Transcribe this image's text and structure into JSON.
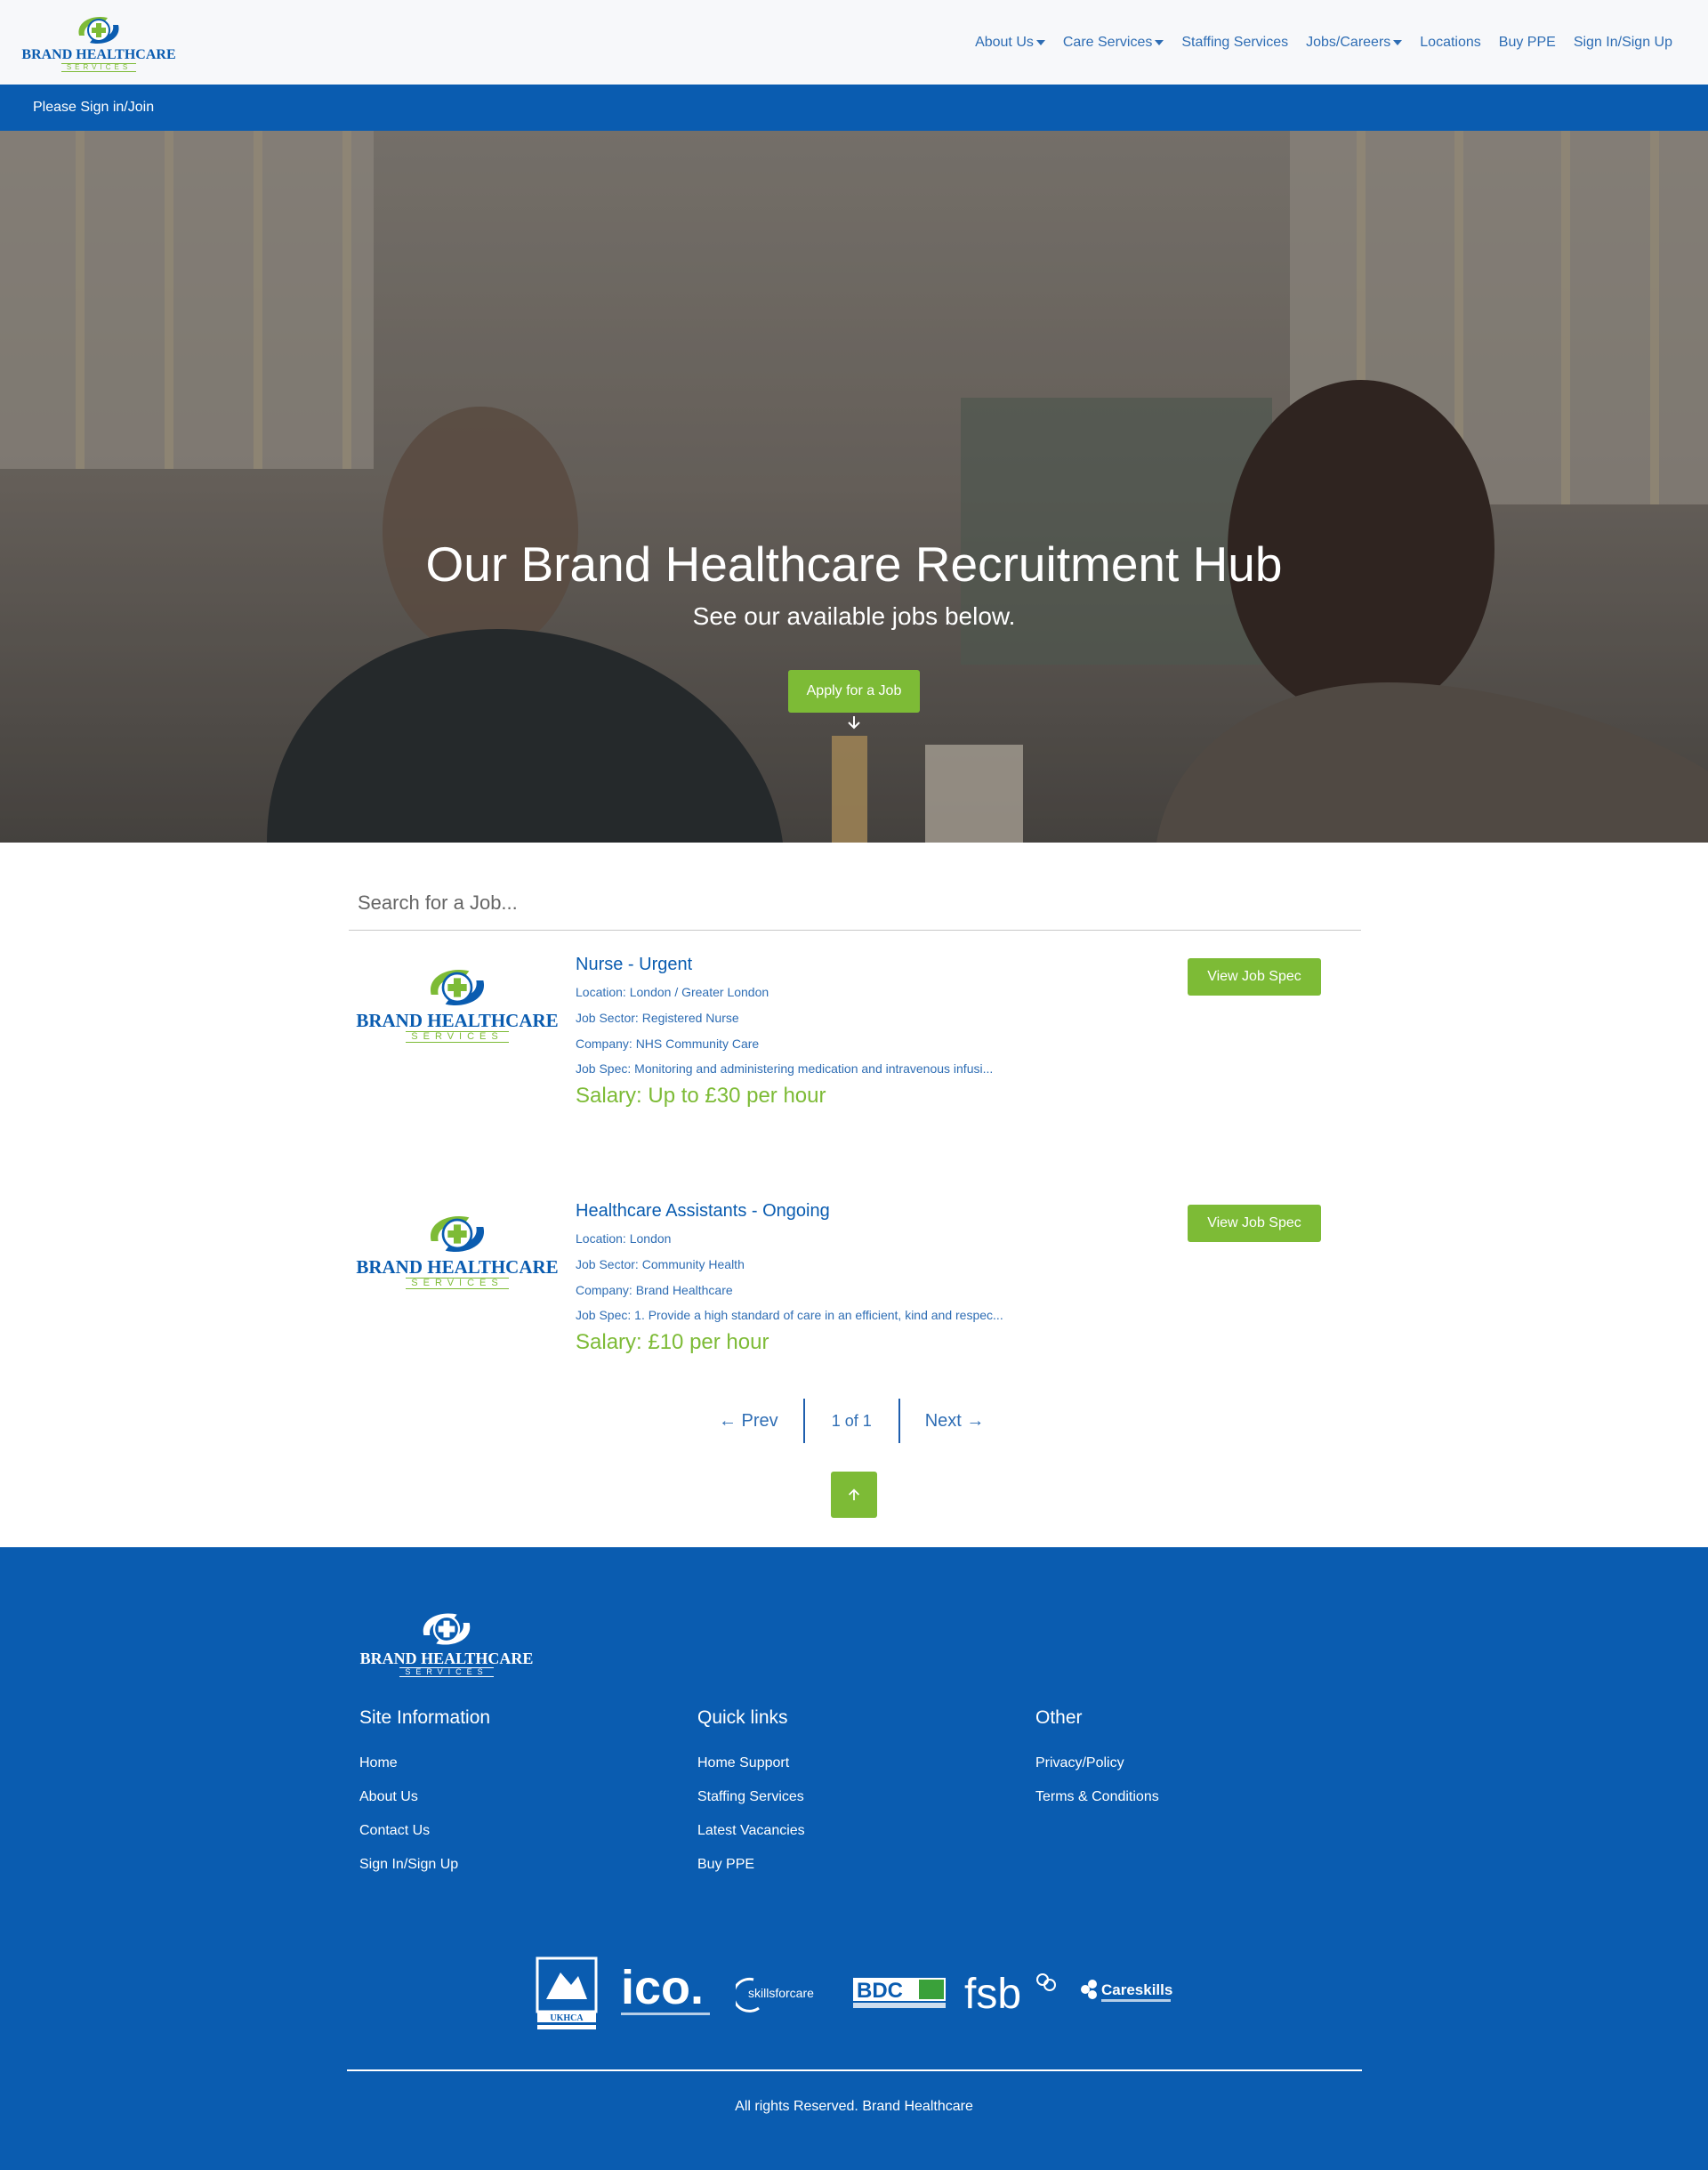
{
  "brand": {
    "name": "BRAND HEALTHCARE",
    "sub": "SERVICES",
    "primary": "#0a5cb0",
    "accent": "#7dbb36"
  },
  "nav": {
    "items": [
      {
        "label": "About Us",
        "dropdown": true
      },
      {
        "label": "Care Services",
        "dropdown": true
      },
      {
        "label": "Staffing Services",
        "dropdown": false
      },
      {
        "label": "Jobs/Careers",
        "dropdown": true
      },
      {
        "label": "Locations",
        "dropdown": false
      },
      {
        "label": "Buy PPE",
        "dropdown": false
      },
      {
        "label": "Sign In/Sign Up",
        "dropdown": false
      }
    ]
  },
  "signin_bar": {
    "text": "Please Sign in/Join"
  },
  "hero": {
    "title": "Our Brand Healthcare Recruitment Hub",
    "subtitle": "See our available jobs below.",
    "cta": "Apply for a Job",
    "scroll_icon": "arrow-down-icon"
  },
  "search": {
    "placeholder": "Search for a Job..."
  },
  "jobs": [
    {
      "title": "Nurse - Urgent",
      "location": "Location: London / Greater London",
      "sector": "Job Sector: Registered Nurse",
      "company": "Company: NHS Community Care",
      "spec": "Job Spec: Monitoring and administering medication and intravenous infusi...",
      "salary": "Salary: Up to £30 per hour",
      "button": "View Job Spec"
    },
    {
      "title": "Healthcare Assistants - Ongoing",
      "location": "Location: London",
      "sector": "Job Sector: Community Health",
      "company": "Company: Brand Healthcare",
      "spec": "Job Spec: 1. Provide a high standard of care in an efficient, kind and respec...",
      "salary": "Salary: £10 per hour",
      "button": "View Job Spec"
    }
  ],
  "pagination": {
    "prev": "← Prev",
    "current": "1 of 1",
    "next": "Next →"
  },
  "back_to_top": {
    "icon": "arrow-up-icon"
  },
  "footer": {
    "columns": [
      {
        "heading": "Site Information",
        "links": [
          "Home",
          "About Us",
          "Contact Us",
          "Sign In/Sign Up"
        ]
      },
      {
        "heading": "Quick links",
        "links": [
          "Home Support",
          "Staffing Services",
          "Latest Vacancies",
          "Buy PPE"
        ]
      },
      {
        "heading": "Other",
        "links": [
          "Privacy/Policy",
          "Terms & Conditions"
        ]
      }
    ],
    "partners": [
      {
        "name": "UKHCA",
        "label": "UKHCA"
      },
      {
        "name": "ico",
        "label": "ico."
      },
      {
        "name": "skillsforcare",
        "label": "skillsforcare"
      },
      {
        "name": "BDC",
        "label": "BDC"
      },
      {
        "name": "fsb",
        "label": "fsb"
      },
      {
        "name": "Careskills Academy",
        "label": "Careskills"
      }
    ],
    "copyright": "All rights Reserved. Brand Healthcare"
  }
}
